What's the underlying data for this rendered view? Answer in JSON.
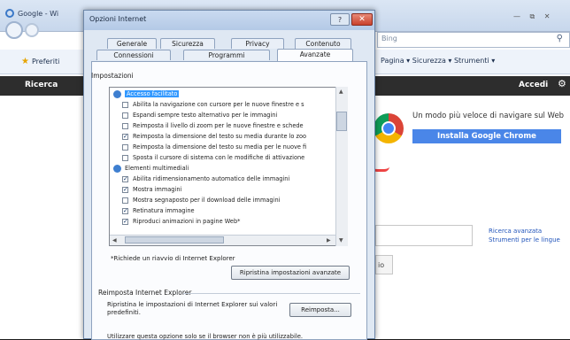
{
  "browser": {
    "tab_title": "Google - Wi",
    "address_text": "Bing",
    "window_controls": "— ⧉ ✕",
    "favorites_label": "Preferiti",
    "command_bar": "Pagina ▾  Sicurezza ▾  Strumenti ▾",
    "dark_bar_left": "Ricerca",
    "dark_bar_right": "Accedi",
    "chrome_promo_text": "Un modo più veloce di navigare sul Web",
    "chrome_install_label": "Installa Google Chrome",
    "advanced_links": [
      "Ricerca avanzata",
      "Strumenti per le lingue"
    ],
    "search_button_partial": "io"
  },
  "dialog": {
    "title": "Opzioni Internet",
    "help_label": "?",
    "close_label": "✕",
    "tabs_row1": [
      "Generale",
      "Sicurezza",
      "Privacy",
      "Contenuto"
    ],
    "tabs_row2": [
      "Connessioni",
      "Programmi",
      "Avanzate"
    ],
    "active_tab": "Avanzate",
    "settings_label": "Impostazioni",
    "settings_items": [
      {
        "label": "Accesso facilitato",
        "type": "category",
        "selected": true
      },
      {
        "label": "Abilita la navigazione con cursore per le nuove finestre e s",
        "checked": false
      },
      {
        "label": "Espandi sempre testo alternativo per le immagini",
        "checked": false
      },
      {
        "label": "Reimposta il livello di zoom per le nuove finestre e schede",
        "checked": false
      },
      {
        "label": "Reimposta la dimensione del testo su media durante lo zoo",
        "checked": true
      },
      {
        "label": "Reimposta la dimensione del testo su media per le nuove fi",
        "checked": false
      },
      {
        "label": "Sposta il cursore di sistema con le modifiche di attivazione",
        "checked": false
      },
      {
        "label": "Elementi multimediali",
        "type": "category",
        "selected": false
      },
      {
        "label": "Abilita ridimensionamento automatico delle immagini",
        "checked": true
      },
      {
        "label": "Mostra immagini",
        "checked": true
      },
      {
        "label": "Mostra segnaposto per il download delle immagini",
        "checked": false
      },
      {
        "label": "Retinatura immagine",
        "checked": true
      },
      {
        "label": "Riproduci animazioni in pagine Web*",
        "checked": true
      }
    ],
    "restart_note": "*Richiede un riavvio di Internet Explorer",
    "restore_button": "Ripristina impostazioni avanzate",
    "reset_group_label": "Reimposta Internet Explorer",
    "reset_description": "Ripristina le impostazioni di Internet Explorer sui valori predefiniti.",
    "reset_button": "Reimposta...",
    "reset_note": "Utilizzare questa opzione solo se il browser non è più utilizzabile."
  },
  "colors": {
    "selection": "#3399ff",
    "chrome_button": "#4a86e8",
    "dark_bar": "#2d2d2d"
  }
}
